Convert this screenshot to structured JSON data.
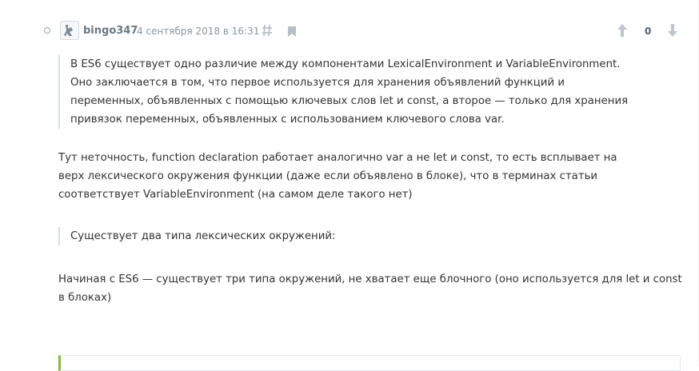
{
  "comment": {
    "username": "bingo347",
    "date": "4 сентября 2018 в 16:31",
    "score": "0",
    "icons": {
      "avatar": "avatar-image",
      "permalink": "hash-icon",
      "bookmark": "bookmark-icon",
      "vote_up": "arrow-up-icon",
      "vote_down": "arrow-down-icon"
    },
    "quote1": "В ES6 существует одно различие между компонентами LexicalEnvironment и VariableEnvironment. Оно заключается в том, что первое используется для хранения объявлений функций и переменных, объявленных с помощью ключевых слов let и const, а второе — только для хранения привязок переменных, объявленных с использованием ключевого слова var.",
    "para1": "Тут неточность, function declaration работает аналогично var а не let и const, то есть всплывает на верх лексического окружения функции (даже если объявлено в блоке), что в терминах статьи соответствует VariableEnvironment (на самом деле такого нет)",
    "quote2": "Существует два типа лексических окружений:",
    "para2": "Начиная с ES6 — существует три типа окружений, не хватает еще блочного (оно используется для let и const в блоках)"
  },
  "colors": {
    "accent_green": "#8ab845",
    "meta_gray": "#8c959d",
    "quote_border": "#d4dde3"
  }
}
